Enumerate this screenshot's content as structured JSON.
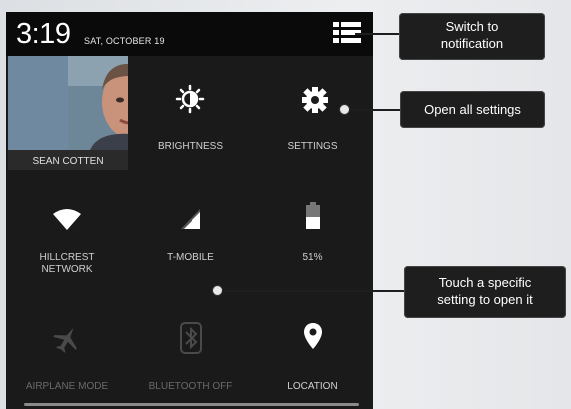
{
  "status": {
    "time": "3:19",
    "date": "SAT, OCTOBER 19"
  },
  "profile": {
    "name": "SEAN COTTEN"
  },
  "tiles": {
    "brightness": "BRIGHTNESS",
    "settings": "SETTINGS",
    "wifi": "HILLCREST\nNETWORK",
    "signal": "T-MOBILE",
    "battery": "51%",
    "airplane": "AIRPLANE MODE",
    "bluetooth": "BLUETOOTH OFF",
    "location": "LOCATION"
  },
  "callouts": {
    "switch": "Switch to\nnotification",
    "settings": "Open all settings",
    "touch": "Touch a specific\nsetting to open it"
  },
  "icons": {
    "switch": "list-icon",
    "brightness": "sun-icon",
    "settings": "gear-icon",
    "wifi": "wifi-icon",
    "signal": "signal-icon",
    "battery": "battery-icon",
    "airplane": "airplane-icon",
    "bluetooth": "bluetooth-icon",
    "location": "location-pin-icon"
  }
}
